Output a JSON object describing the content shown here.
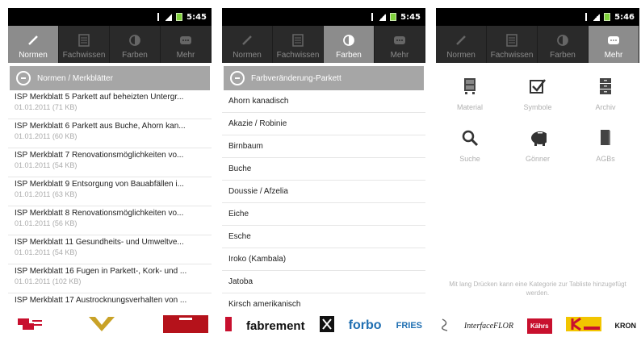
{
  "status": {
    "times": [
      "5:45",
      "5:45",
      "5:46"
    ]
  },
  "tabs": [
    {
      "label": "Normen",
      "icon": "pencil-icon"
    },
    {
      "label": "Fachwissen",
      "icon": "book-icon"
    },
    {
      "label": "Farben",
      "icon": "palette-icon"
    },
    {
      "label": "Mehr",
      "icon": "more-icon"
    }
  ],
  "screen1": {
    "active_tab": 0,
    "header": "Normen / Merkblätter",
    "items": [
      {
        "title": "ISP Merkblatt 5 Parkett auf beheizten Untergr...",
        "meta": "01.01.2011 (71 KB)"
      },
      {
        "title": "ISP Merkblatt 6 Parkett aus Buche, Ahorn kan...",
        "meta": "01.01.2011 (60 KB)"
      },
      {
        "title": "ISP Merkblatt 7 Renovationsmöglichkeiten vo...",
        "meta": "01.01.2011 (54 KB)"
      },
      {
        "title": "ISP Merkblatt 9 Entsorgung von Bauabfällen i...",
        "meta": "01.01.2011 (63 KB)"
      },
      {
        "title": "ISP Merkblatt 8 Renovationsmöglichkeiten vo...",
        "meta": "01.01.2011 (56 KB)"
      },
      {
        "title": "ISP Merkblatt 11 Gesundheits- und Umweltve...",
        "meta": "01.01.2011 (54 KB)"
      },
      {
        "title": "ISP Merkblatt 16 Fugen in Parkett-, Kork- und ...",
        "meta": "01.01.2011 (102 KB)"
      },
      {
        "title": "ISP Merkblatt 17 Austrocknungsverhalten von ...",
        "meta": ""
      }
    ]
  },
  "screen2": {
    "active_tab": 2,
    "header": "Farbveränderung-Parkett",
    "items": [
      "Ahorn kanadisch",
      "Akazie / Robinie",
      "Birnbaum",
      "Buche",
      "Doussie / Afzelia",
      "Eiche",
      "Esche",
      "Iroko (Kambala)",
      "Jatoba",
      "Kirsch amerikanisch"
    ]
  },
  "screen3": {
    "active_tab": 3,
    "grid": [
      {
        "label": "Material",
        "icon": "cabinet-icon"
      },
      {
        "label": "Symbole",
        "icon": "checkbox-icon"
      },
      {
        "label": "Archiv",
        "icon": "archive-icon"
      },
      {
        "label": "Suche",
        "icon": "search-icon"
      },
      {
        "label": "Gönner",
        "icon": "piggy-bank-icon"
      },
      {
        "label": "AGBs",
        "icon": "book-icon"
      }
    ],
    "hint": "Mit lang Drücken kann eine Kategorie zur Tabliste hinzugefügt werden."
  },
  "ads": {
    "screen2": {
      "brand1": "fabrement",
      "brand2": "forbo",
      "brand3": "FRIES"
    },
    "screen3": {
      "brand1": "InterfaceFLOR",
      "brand2": "Kährs",
      "brand3": "KRON"
    }
  },
  "colors": {
    "active_tab": "#8c8c8c",
    "tabbar": "#2a2a2a",
    "header": "#a6a6a6",
    "battery": "#7fd13b",
    "accent_red": "#c8102e"
  }
}
